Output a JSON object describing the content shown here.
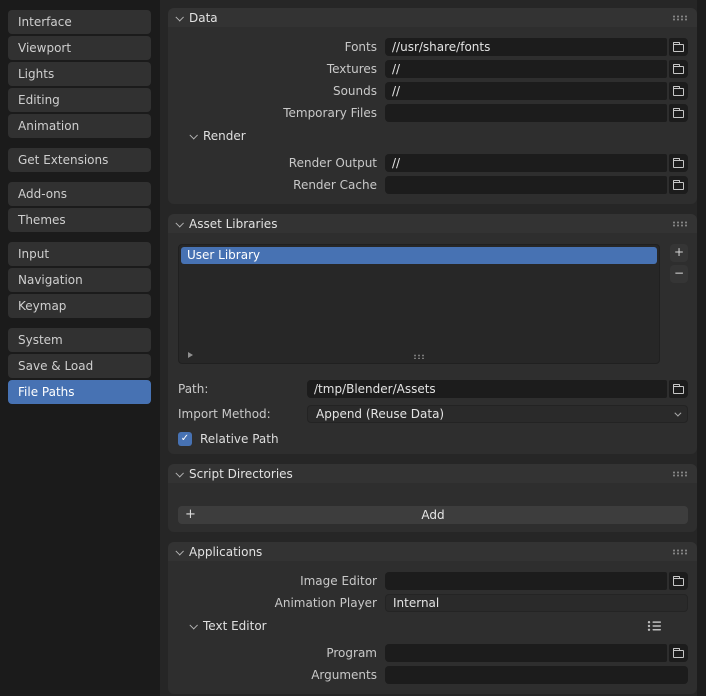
{
  "colors": {
    "accent": "#4772b3",
    "panel_bg": "#2e2e2e",
    "field_bg": "#1c1c1c"
  },
  "glyphs": {
    "plus": "+",
    "minus": "−",
    "check": "✓"
  },
  "sidebar": {
    "items": [
      {
        "label": "Interface"
      },
      {
        "label": "Viewport"
      },
      {
        "label": "Lights"
      },
      {
        "label": "Editing"
      },
      {
        "label": "Animation"
      },
      {
        "label": "Get Extensions"
      },
      {
        "label": "Add-ons"
      },
      {
        "label": "Themes"
      },
      {
        "label": "Input"
      },
      {
        "label": "Navigation"
      },
      {
        "label": "Keymap"
      },
      {
        "label": "System"
      },
      {
        "label": "Save & Load"
      },
      {
        "label": "File Paths"
      }
    ],
    "active": "File Paths"
  },
  "data_panel": {
    "title": "Data",
    "rows": [
      {
        "label": "Fonts",
        "value": "//usr/share/fonts"
      },
      {
        "label": "Textures",
        "value": "//"
      },
      {
        "label": "Sounds",
        "value": "//"
      },
      {
        "label": "Temporary Files",
        "value": ""
      }
    ],
    "render": {
      "title": "Render",
      "rows": [
        {
          "label": "Render Output",
          "value": "//"
        },
        {
          "label": "Render Cache",
          "value": ""
        }
      ]
    }
  },
  "asset_libraries": {
    "title": "Asset Libraries",
    "selected_item": "User Library",
    "path_label": "Path:",
    "path_value": "/tmp/Blender/Assets",
    "import_label": "Import Method:",
    "import_value": "Append (Reuse Data)",
    "relative_path_label": "Relative Path",
    "relative_path_checked": true
  },
  "script_directories": {
    "title": "Script Directories",
    "add_label": "Add"
  },
  "applications": {
    "title": "Applications",
    "rows": [
      {
        "label": "Image Editor",
        "value": ""
      },
      {
        "label": "Animation Player",
        "value": "Internal"
      }
    ],
    "text_editor": {
      "title": "Text Editor",
      "rows": [
        {
          "label": "Program",
          "value": ""
        },
        {
          "label": "Arguments",
          "value": ""
        }
      ]
    }
  }
}
